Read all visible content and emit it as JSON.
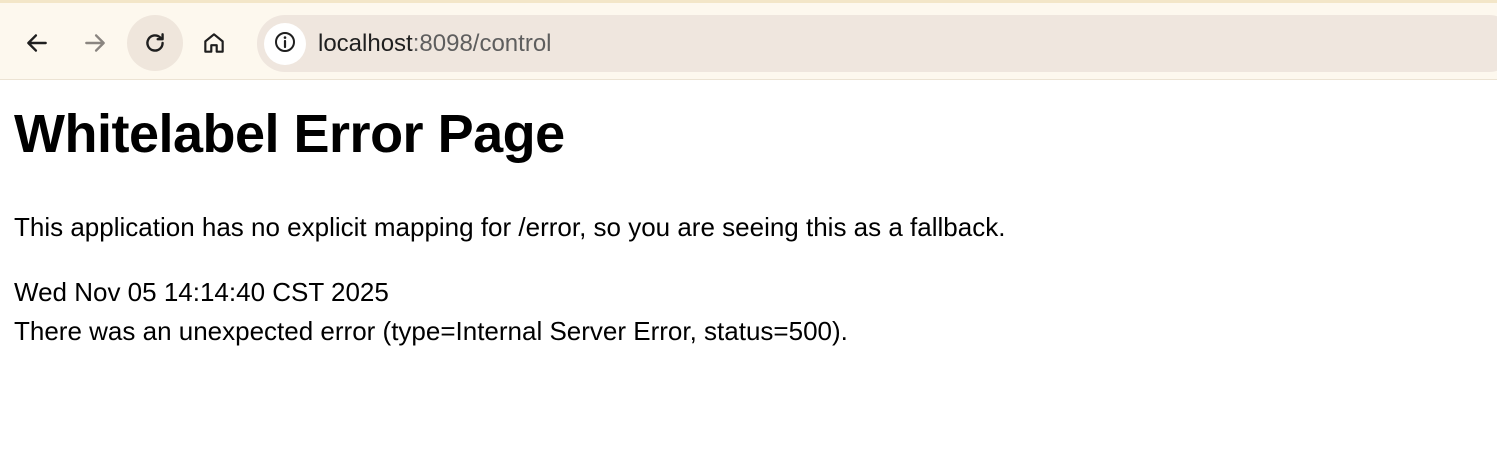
{
  "browser": {
    "url_host": "localhost",
    "url_rest": ":8098/control",
    "icons": {
      "back": "arrow-left-icon",
      "forward": "arrow-right-icon",
      "reload": "reload-icon",
      "home": "home-icon",
      "site_info": "info-icon"
    },
    "colors": {
      "toolbar_bg": "#fdf8ee",
      "omnibox_bg": "#efe6de",
      "reload_hover_bg": "#efe6dc"
    }
  },
  "page": {
    "heading": "Whitelabel Error Page",
    "fallback_message": "This application has no explicit mapping for /error, so you are seeing this as a fallback.",
    "timestamp": "Wed Nov 05 14:14:40 CST 2025",
    "error_message": "There was an unexpected error (type=Internal Server Error, status=500)."
  }
}
